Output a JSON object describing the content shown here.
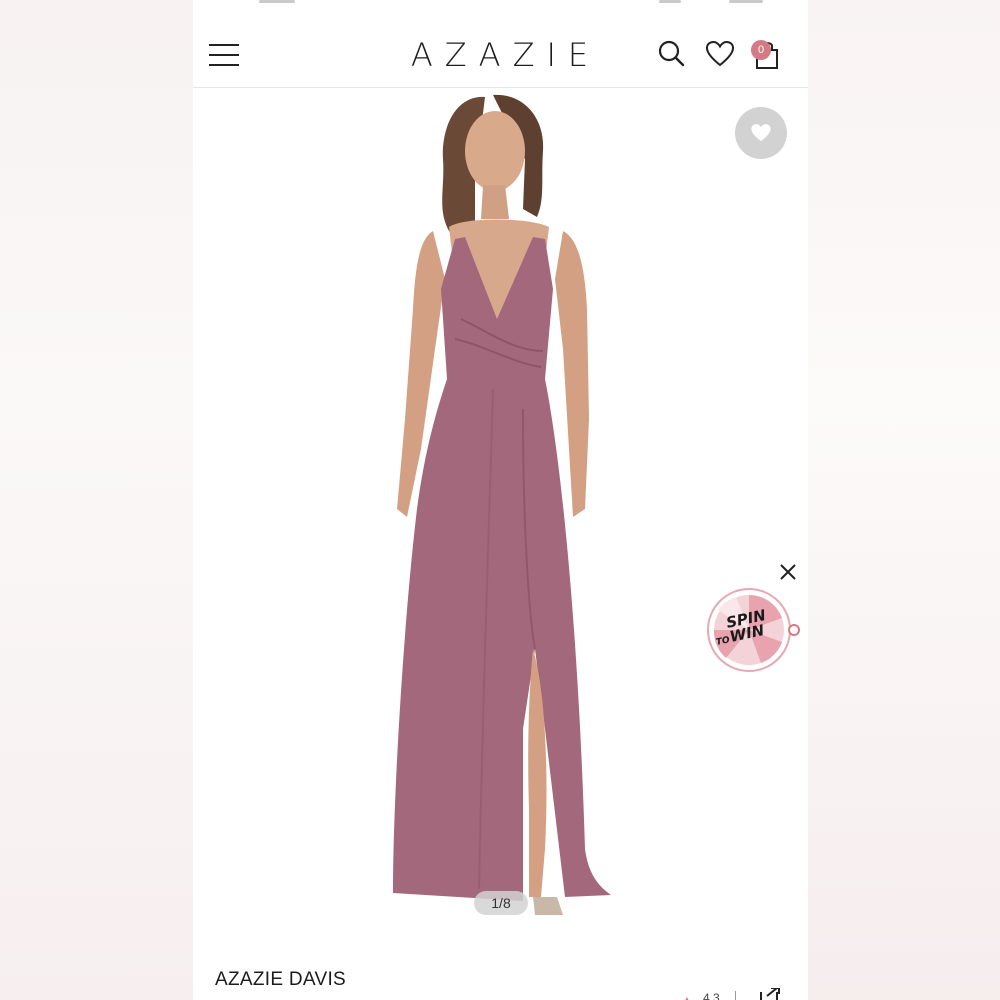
{
  "header": {
    "logo": "AZAZIE",
    "cart_count": "0"
  },
  "product": {
    "name": "AZAZIE DAVIS",
    "image_counter": "1/8",
    "rating": "4.3",
    "dress_color": "#a4687d"
  },
  "promo": {
    "line1": "SPIN",
    "line2_small": "TO",
    "line2": "WIN"
  },
  "colors": {
    "accent": "#d47a86",
    "wish_button": "#d2d2d2"
  },
  "icons": [
    "menu-icon",
    "search-icon",
    "heart-icon",
    "bag-icon",
    "heart-icon",
    "close-icon",
    "star-icon",
    "share-icon"
  ]
}
